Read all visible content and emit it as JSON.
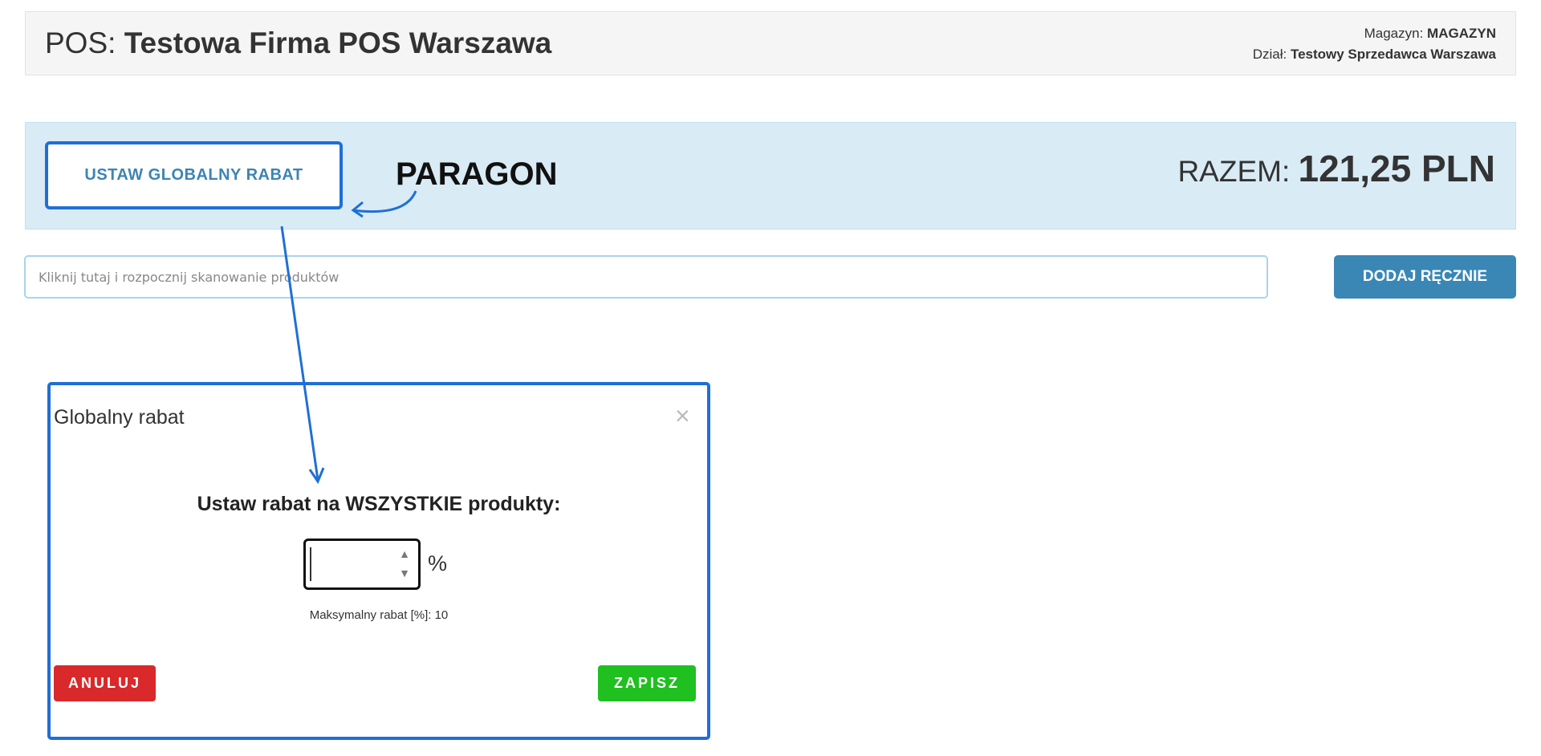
{
  "header": {
    "pos_label": "POS: ",
    "company": "Testowa Firma POS Warszawa",
    "warehouse_label": "Magazyn: ",
    "warehouse_value": "MAGAZYN",
    "dept_label": "Dział: ",
    "dept_value": "Testowy Sprzedawca Warszawa"
  },
  "banner": {
    "global_discount_button": "USTAW GLOBALNY RABAT",
    "doc_type": "PARAGON",
    "total_label": "RAZEM: ",
    "total_value": "121,25 PLN"
  },
  "scan": {
    "placeholder": "Kliknij tutaj i rozpocznij skanowanie produktów",
    "add_button": "DODAJ RĘCZNIE"
  },
  "modal": {
    "title": "Globalny rabat",
    "close": "×",
    "question": "Ustaw rabat na WSZYSTKIE produkty:",
    "percent_sign": "%",
    "max_label": "Maksymalny rabat [%]: 10",
    "cancel": "ANULUJ",
    "save": "ZAPISZ"
  },
  "colors": {
    "highlight": "#1f6fd6",
    "banner_bg": "#d9ebf5",
    "primary": "#3a87b5",
    "danger": "#d9292b",
    "success": "#1fc01f"
  }
}
